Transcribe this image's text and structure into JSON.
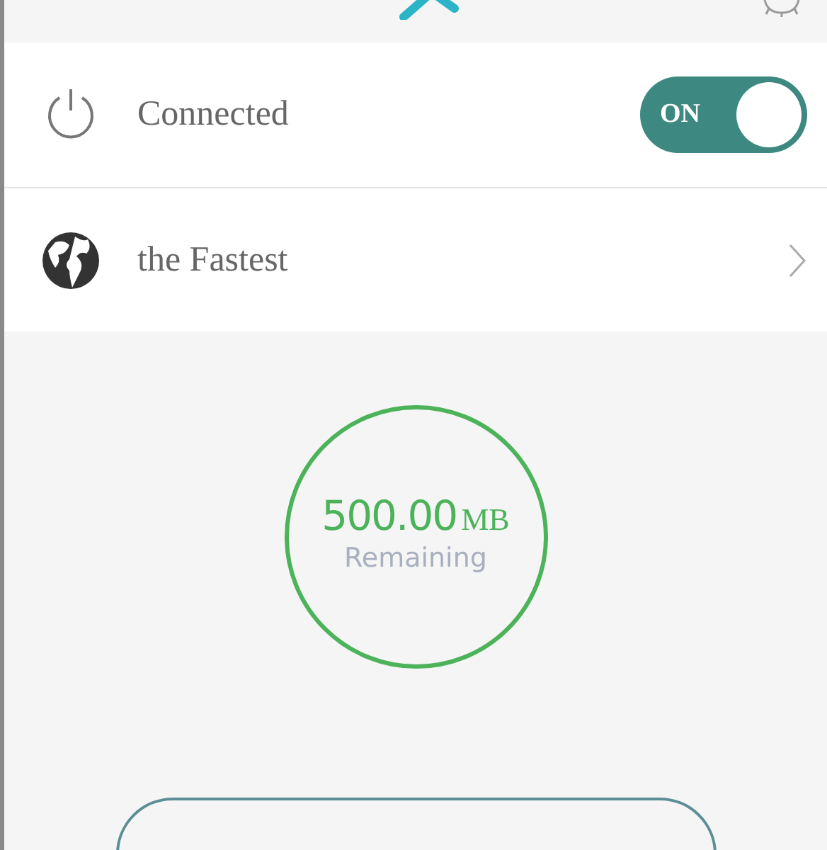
{
  "status_row": {
    "label": "Connected",
    "toggle": {
      "label": "ON",
      "on": true
    }
  },
  "server_row": {
    "label": "the Fastest"
  },
  "data_meter": {
    "amount": "500.00",
    "unit": "MB",
    "caption": "Remaining"
  }
}
